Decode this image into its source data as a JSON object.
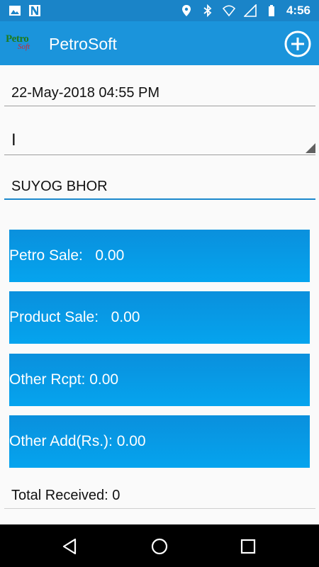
{
  "status_bar": {
    "time": "4:56",
    "left_icons": [
      "image-icon",
      "n-icon"
    ],
    "right_icons": [
      "location-icon",
      "bluetooth-icon",
      "wifi-icon",
      "signal-icon",
      "battery-icon"
    ]
  },
  "app_bar": {
    "logo_text_top": "Petro",
    "logo_text_bottom": "Soft",
    "title": "PetroSoft",
    "action_icon": "add-circle-icon",
    "color": "#1b94db"
  },
  "form": {
    "datetime": "22-May-2018 04:55 PM",
    "spinner_value": "I",
    "name": "SUYOG BHOR",
    "accent_color": "#1b88cc"
  },
  "tiles": [
    {
      "label": "Petro Sale:",
      "value": "0.00",
      "text": "Petro Sale:   0.00"
    },
    {
      "label": "Product Sale:",
      "value": "0.00",
      "text": "Product Sale:   0.00"
    },
    {
      "label": "Other Rcpt:",
      "value": "0.00",
      "text": "Other Rcpt: 0.00"
    },
    {
      "label": "Other Add(Rs.):",
      "value": "0.00",
      "text": "Other Add(Rs.): 0.00"
    }
  ],
  "tile_color": "#0a90dd",
  "total": {
    "text": "Total Received: 0"
  },
  "nav_bar": {
    "icons": [
      "back-icon",
      "home-icon",
      "recents-icon"
    ]
  }
}
